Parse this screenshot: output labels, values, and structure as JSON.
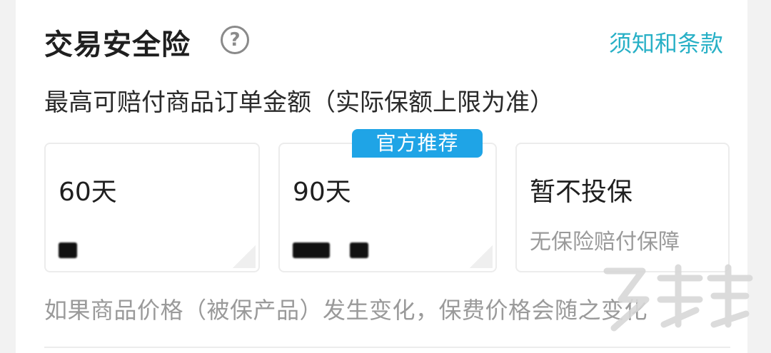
{
  "header": {
    "title": "交易安全险",
    "help_icon": "question-circle-icon",
    "terms_link": "须知和条款"
  },
  "subtitle": "最高可赔付商品订单金额（实际保额上限为准）",
  "options": [
    {
      "label": "60天",
      "desc": ""
    },
    {
      "label": "90天",
      "desc": "",
      "badge": "官方推荐"
    },
    {
      "label": "暂不投保",
      "desc": "无保险赔付保障"
    }
  ],
  "notice": "如果商品价格（被保产品）发生变化，保费价格会随之变化",
  "colors": {
    "accent": "#28b0c6",
    "badge": "#1fa4e6",
    "text": "#1f1f1f",
    "muted": "#9a9a9a"
  }
}
